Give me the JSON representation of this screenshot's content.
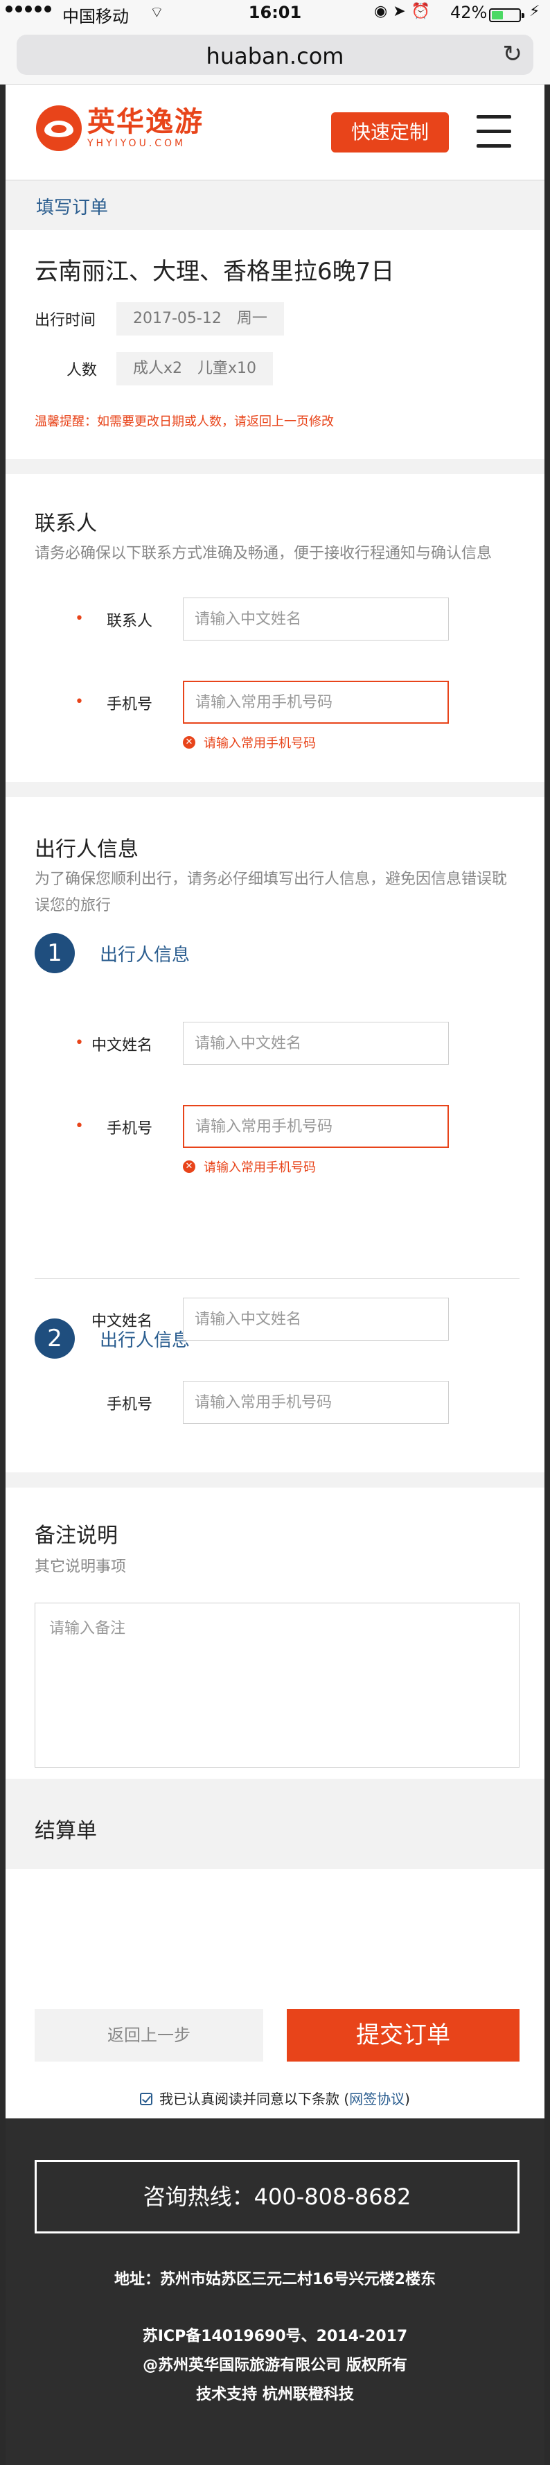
{
  "status_bar": {
    "carrier": "中国移动",
    "time": "16:01",
    "battery_pct": "42%"
  },
  "browser": {
    "url": "huaban.com"
  },
  "header": {
    "logo_cn": "英华逸游",
    "logo_en": "YHYIYOU.COM",
    "custom_button": "快速定制"
  },
  "breadcrumb": "填写订单",
  "trip": {
    "title": "云南丽江、大理、香格里拉6晚7日",
    "date_label": "出行时间",
    "date_value": "2017-05-12　周一",
    "people_label": "人数",
    "people_value": "成人x2　儿童x10",
    "reminder": "温馨提醒：如需要更改日期或人数，请返回上一页修改"
  },
  "contact": {
    "title": "联系人",
    "desc": "请务必确保以下联系方式准确及畅通，便于接收行程通知与确认信息",
    "name_label": "联系人",
    "name_placeholder": "请输入中文姓名",
    "phone_label": "手机号",
    "phone_placeholder": "请输入常用手机号码",
    "phone_error": "请输入常用手机号码"
  },
  "travelers": {
    "title": "出行人信息",
    "desc": "为了确保您顺利出行，请务必仔细填写出行人信息，避免因信息错误耽误您的旅行",
    "list": [
      {
        "num": "1",
        "title": "出行人信息",
        "name_label": "中文姓名",
        "name_placeholder": "请输入中文姓名",
        "phone_label": "手机号",
        "phone_placeholder": "请输入常用手机号码",
        "phone_error": "请输入常用手机号码"
      },
      {
        "num": "2",
        "title": "出行人信息",
        "name_label": "中文姓名",
        "name_placeholder": "请输入中文姓名",
        "phone_label": "手机号",
        "phone_placeholder": "请输入常用手机号码"
      }
    ]
  },
  "remarks": {
    "title": "备注说明",
    "desc": "其它说明事项",
    "placeholder": "请输入备注"
  },
  "settlement": {
    "title": "结算单"
  },
  "actions": {
    "back": "返回上一步",
    "submit": "提交订单",
    "agree_text": "我已认真阅读并同意以下条款 (",
    "agree_link": "网签协议",
    "agree_end": ")"
  },
  "footer": {
    "hotline": "咨询热线：400-808-8682",
    "address": "地址：苏州市姑苏区三元二村16号兴元楼2楼东",
    "icp": "苏ICP备14019690号、2014-2017",
    "copyright": "@苏州英华国际旅游有限公司 版权所有",
    "support": "技术支持  杭州联橙科技"
  },
  "colors": {
    "accent": "#e8441a",
    "brand_blue": "#1f4e7e",
    "link_blue": "#2a5d8f",
    "footer_bg": "#2e2e2e"
  }
}
